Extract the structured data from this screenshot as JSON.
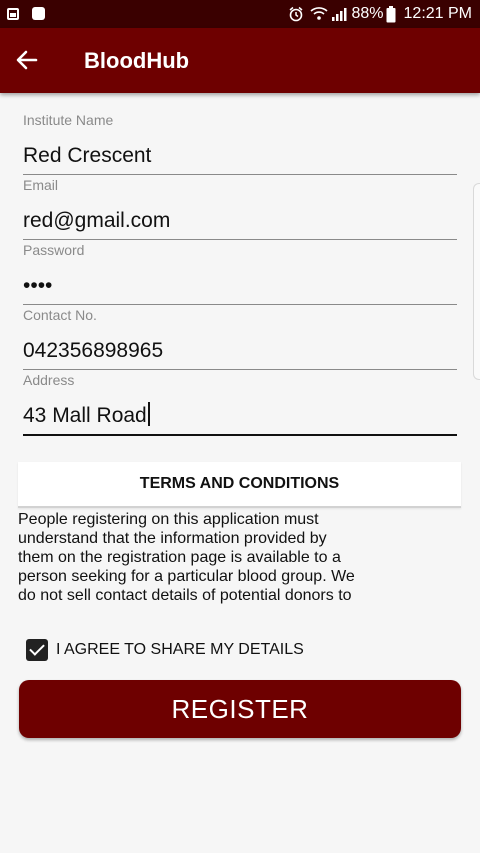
{
  "status_bar": {
    "battery": "88%",
    "time": "12:21 PM"
  },
  "app_bar": {
    "title": "BloodHub"
  },
  "form": {
    "institute_name": {
      "label": "Institute Name",
      "value": "Red Crescent"
    },
    "email": {
      "label": "Email",
      "value": "red@gmail.com"
    },
    "password": {
      "label": "Password",
      "value": "••••"
    },
    "contact": {
      "label": "Contact No.",
      "value": "042356898965"
    },
    "address": {
      "label": "Address",
      "value": "43 Mall Road"
    }
  },
  "terms": {
    "title": "TERMS AND CONDITIONS",
    "body": "People registering on this application must understand that the information provided by them on the registration page is available to a person seeking for a particular blood group. We do not sell contact details of potential donors to any third party or provide..."
  },
  "agree": {
    "label": "I AGREE TO SHARE MY DETAILS",
    "checked": true
  },
  "register": {
    "label": "REGISTER"
  },
  "colors": {
    "primary": "#6e0000",
    "status_bar": "#3a0000"
  }
}
